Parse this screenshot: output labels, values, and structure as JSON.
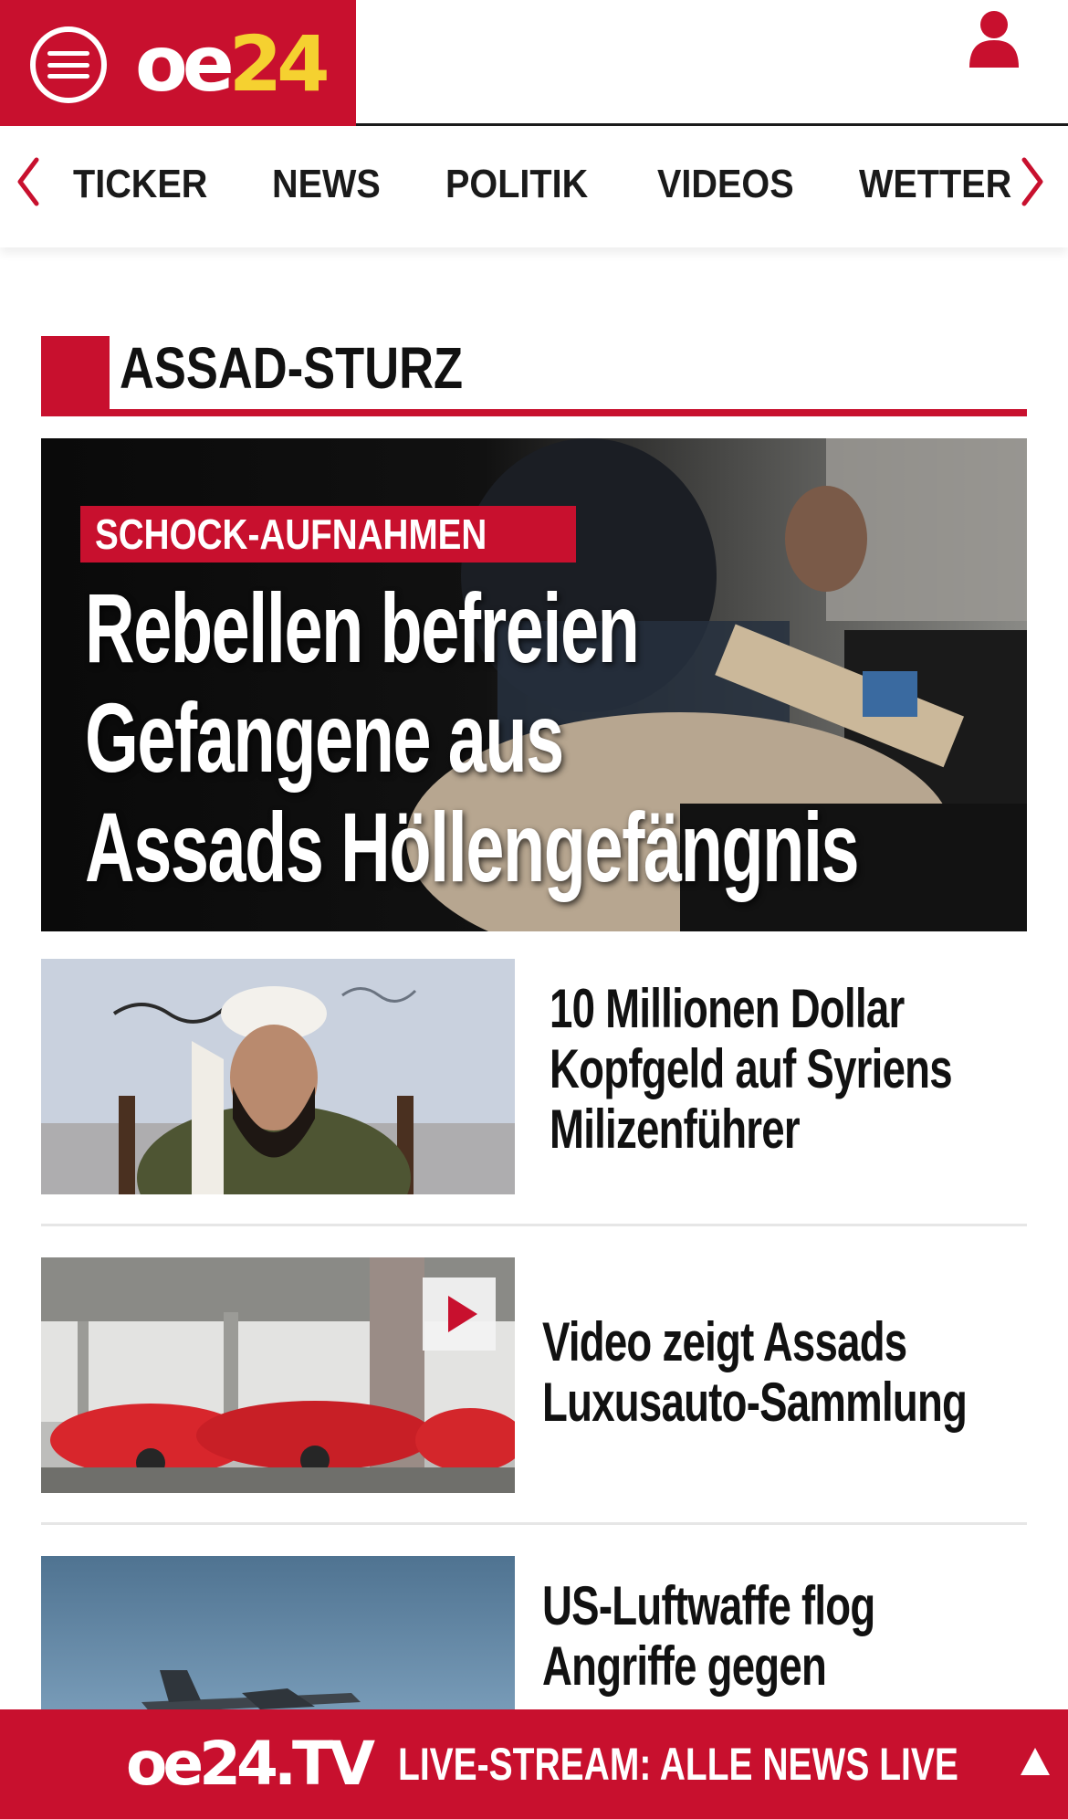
{
  "header": {
    "logo_main": "oe",
    "logo_number": "24",
    "menu_icon": "hamburger-menu-icon",
    "user_icon": "user-account-icon",
    "brand_color": "#c8102e",
    "logo_accent_color": "#f5d130"
  },
  "nav": {
    "items": [
      {
        "label": "TICKER"
      },
      {
        "label": "NEWS"
      },
      {
        "label": "POLITIK"
      },
      {
        "label": "VIDEOS"
      },
      {
        "label": "WETTER"
      }
    ],
    "left_icon": "chevron-left-icon",
    "right_icon": "chevron-right-icon"
  },
  "section": {
    "title": "ASSAD-STURZ"
  },
  "hero": {
    "kicker": "SCHOCK-AUFNAHMEN",
    "headline_lines": [
      "Rebellen befreien",
      "Gefangene aus",
      "Assads Höllengefängnis"
    ]
  },
  "articles": [
    {
      "title": "10 Millionen Dollar Kopfgeld auf Syriens Milizenführer",
      "has_video": false
    },
    {
      "title": "Video zeigt Assads Luxusauto-Sammlung",
      "has_video": true,
      "video_icon": "play-icon"
    },
    {
      "title": "US-Luftwaffe flog Angriffe gegen",
      "has_video": false
    }
  ],
  "live_bar": {
    "logo": "oe24.TV",
    "text": "LIVE-STREAM:  ALLE NEWS LIVE",
    "icon": "triangle-up-icon"
  }
}
